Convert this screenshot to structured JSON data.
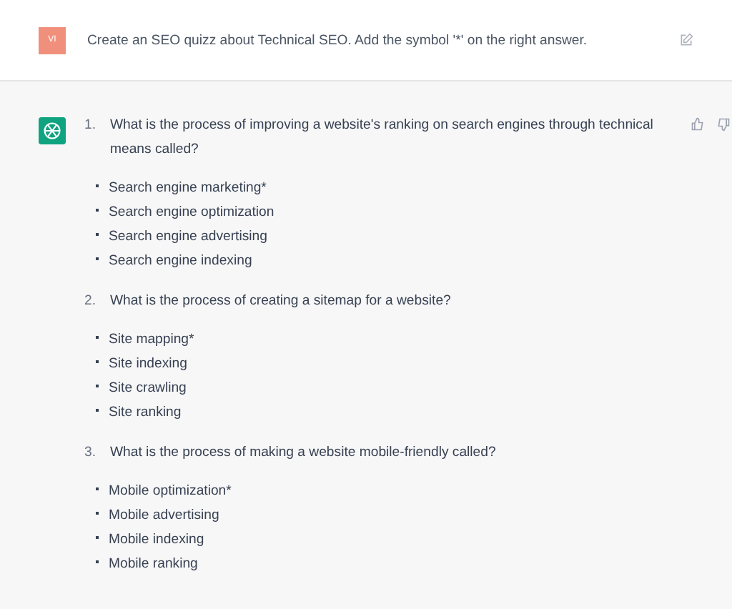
{
  "user_message": {
    "avatar": "VI",
    "text": "Create an SEO quizz about Technical SEO. Add the symbol '*' on the right answer."
  },
  "assistant_message": {
    "questions": [
      {
        "number": "1.",
        "text": "What is the process of improving a website's ranking on search engines through technical means called?",
        "answers": [
          "Search engine marketing*",
          "Search engine optimization",
          "Search engine advertising",
          "Search engine indexing"
        ]
      },
      {
        "number": "2.",
        "text": "What is the process of creating a sitemap for a website?",
        "answers": [
          "Site mapping*",
          "Site indexing",
          "Site crawling",
          "Site ranking"
        ]
      },
      {
        "number": "3.",
        "text": "What is the process of making a website mobile-friendly called?",
        "answers": [
          "Mobile optimization*",
          "Mobile advertising",
          "Mobile indexing",
          "Mobile ranking"
        ]
      }
    ]
  }
}
